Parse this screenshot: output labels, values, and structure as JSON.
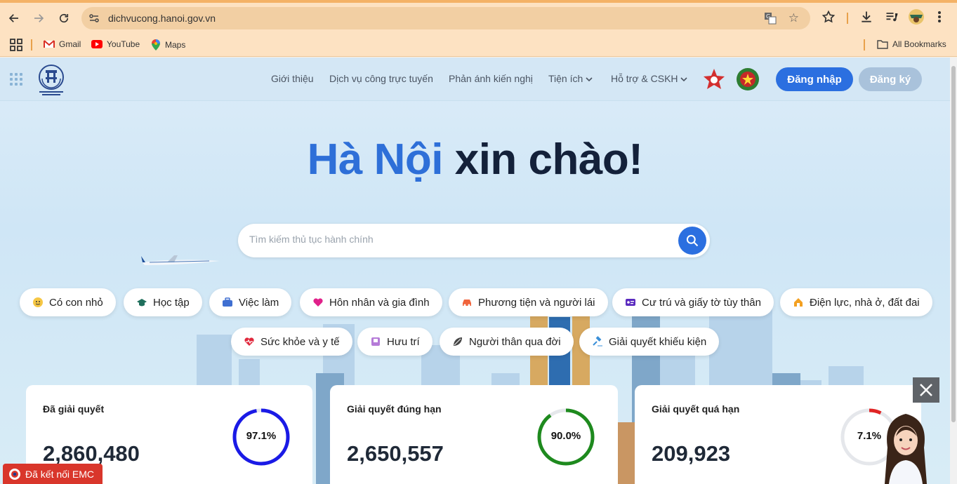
{
  "browser": {
    "url": "dichvucong.hanoi.gov.vn",
    "bookmarks": [
      {
        "label": "Gmail",
        "icon": "gmail-icon"
      },
      {
        "label": "YouTube",
        "icon": "youtube-icon"
      },
      {
        "label": "Maps",
        "icon": "maps-icon"
      }
    ],
    "all_bookmarks": "All Bookmarks"
  },
  "header": {
    "nav": [
      "Giới thiệu",
      "Dịch vụ công trực tuyến",
      "Phản ánh kiến nghị",
      "Tiện ích",
      "Hỗ trợ & CSKH"
    ],
    "login": "Đăng nhập",
    "register": "Đăng ký"
  },
  "hero": {
    "title_highlight": "Hà Nội",
    "title_rest": " xin chào!"
  },
  "search": {
    "placeholder": "Tìm kiếm thủ tục hành chính"
  },
  "categories": [
    {
      "label": "Có con nhỏ",
      "icon": "baby-icon"
    },
    {
      "label": "Học tập",
      "icon": "graduation-cap-icon"
    },
    {
      "label": "Việc làm",
      "icon": "briefcase-icon"
    },
    {
      "label": "Hôn nhân và gia đình",
      "icon": "heart-icon"
    },
    {
      "label": "Phương tiện và người lái",
      "icon": "car-icon"
    },
    {
      "label": "Cư trú và giấy tờ tùy thân",
      "icon": "id-card-icon"
    },
    {
      "label": "Điện lực, nhà ở, đất đai",
      "icon": "house-icon"
    },
    {
      "label": "Sức khỏe và y tế",
      "icon": "health-heart-icon"
    },
    {
      "label": "Hưu trí",
      "icon": "retirement-icon"
    },
    {
      "label": "Người thân qua đời",
      "icon": "leaf-icon"
    },
    {
      "label": "Giải quyết khiếu kiện",
      "icon": "gavel-icon"
    }
  ],
  "stats": [
    {
      "label": "Đã giải quyết",
      "value": "2,860,480",
      "percent_label": "97.1%",
      "percent": 0.971,
      "color": "#1a1ae6"
    },
    {
      "label": "Giải quyết đúng hạn",
      "value": "2,650,557",
      "percent_label": "90.0%",
      "percent": 0.9,
      "color": "#1e8a1e"
    },
    {
      "label": "Giải quyết quá hạn",
      "value": "209,923",
      "percent_label": "7.1%",
      "percent": 0.071,
      "color": "#e02424"
    }
  ],
  "emc": "Đã kết nối EMC"
}
